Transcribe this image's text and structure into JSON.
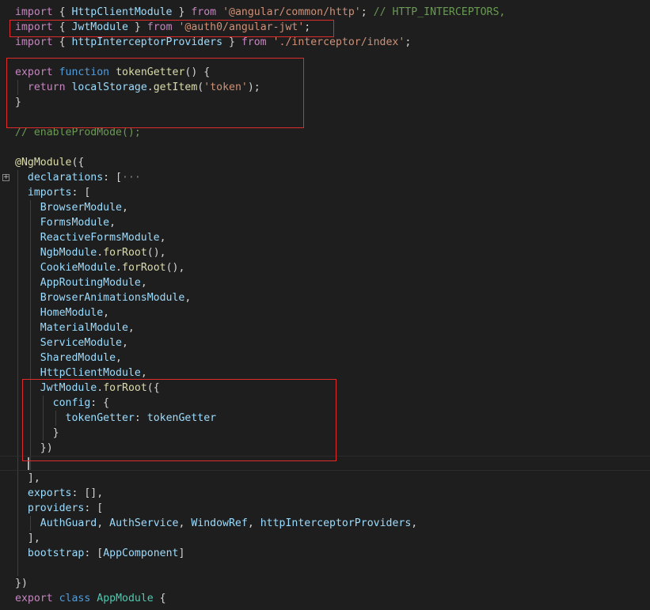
{
  "lines": [
    [
      [
        "kw",
        "import"
      ],
      [
        "pun",
        " { "
      ],
      [
        "var",
        "HttpClientModule"
      ],
      [
        "pun",
        " } "
      ],
      [
        "kw",
        "from"
      ],
      [
        "pun",
        " "
      ],
      [
        "str",
        "'@angular/common/http'"
      ],
      [
        "pun",
        "; "
      ],
      [
        "cmt",
        "// HTTP_INTERCEPTORS,"
      ]
    ],
    [
      [
        "kw",
        "import"
      ],
      [
        "pun",
        " { "
      ],
      [
        "var",
        "JwtModule"
      ],
      [
        "pun",
        " } "
      ],
      [
        "kw",
        "from"
      ],
      [
        "pun",
        " "
      ],
      [
        "str",
        "'@auth0/angular-jwt'"
      ],
      [
        "pun",
        ";"
      ]
    ],
    [
      [
        "kw",
        "import"
      ],
      [
        "pun",
        " { "
      ],
      [
        "var",
        "httpInterceptorProviders"
      ],
      [
        "pun",
        " } "
      ],
      [
        "kw",
        "from"
      ],
      [
        "pun",
        " "
      ],
      [
        "str",
        "'./interceptor/index'"
      ],
      [
        "pun",
        ";"
      ]
    ],
    [],
    [
      [
        "kw",
        "export"
      ],
      [
        "pun",
        " "
      ],
      [
        "kw2",
        "function"
      ],
      [
        "pun",
        " "
      ],
      [
        "fn",
        "tokenGetter"
      ],
      [
        "pun",
        "() {"
      ]
    ],
    [
      [
        "pun",
        "  "
      ],
      [
        "kw",
        "return"
      ],
      [
        "pun",
        " "
      ],
      [
        "var",
        "localStorage"
      ],
      [
        "pun",
        "."
      ],
      [
        "fn",
        "getItem"
      ],
      [
        "pun",
        "("
      ],
      [
        "str",
        "'token'"
      ],
      [
        "pun",
        ");"
      ]
    ],
    [
      [
        "pun",
        "}"
      ]
    ],
    [],
    [
      [
        "cmt",
        "// enableProdMode();"
      ]
    ],
    [],
    [
      [
        "fn",
        "@NgModule"
      ],
      [
        "pun",
        "({"
      ]
    ],
    [
      [
        "pun",
        "  "
      ],
      [
        "var",
        "declarations"
      ],
      [
        "pun",
        ": ["
      ],
      [
        "ellipsis",
        "···"
      ]
    ],
    [
      [
        "pun",
        "  "
      ],
      [
        "var",
        "imports"
      ],
      [
        "pun",
        ": ["
      ]
    ],
    [
      [
        "pun",
        "    "
      ],
      [
        "var",
        "BrowserModule"
      ],
      [
        "pun",
        ","
      ]
    ],
    [
      [
        "pun",
        "    "
      ],
      [
        "var",
        "FormsModule"
      ],
      [
        "pun",
        ","
      ]
    ],
    [
      [
        "pun",
        "    "
      ],
      [
        "var",
        "ReactiveFormsModule"
      ],
      [
        "pun",
        ","
      ]
    ],
    [
      [
        "pun",
        "    "
      ],
      [
        "var",
        "NgbModule"
      ],
      [
        "pun",
        "."
      ],
      [
        "fn",
        "forRoot"
      ],
      [
        "pun",
        "(),"
      ]
    ],
    [
      [
        "pun",
        "    "
      ],
      [
        "var",
        "CookieModule"
      ],
      [
        "pun",
        "."
      ],
      [
        "fn",
        "forRoot"
      ],
      [
        "pun",
        "(),"
      ]
    ],
    [
      [
        "pun",
        "    "
      ],
      [
        "var",
        "AppRoutingModule"
      ],
      [
        "pun",
        ","
      ]
    ],
    [
      [
        "pun",
        "    "
      ],
      [
        "var",
        "BrowserAnimationsModule"
      ],
      [
        "pun",
        ","
      ]
    ],
    [
      [
        "pun",
        "    "
      ],
      [
        "var",
        "HomeModule"
      ],
      [
        "pun",
        ","
      ]
    ],
    [
      [
        "pun",
        "    "
      ],
      [
        "var",
        "MaterialModule"
      ],
      [
        "pun",
        ","
      ]
    ],
    [
      [
        "pun",
        "    "
      ],
      [
        "var",
        "ServiceModule"
      ],
      [
        "pun",
        ","
      ]
    ],
    [
      [
        "pun",
        "    "
      ],
      [
        "var",
        "SharedModule"
      ],
      [
        "pun",
        ","
      ]
    ],
    [
      [
        "pun",
        "    "
      ],
      [
        "var",
        "HttpClientModule"
      ],
      [
        "pun",
        ","
      ]
    ],
    [
      [
        "pun",
        "    "
      ],
      [
        "var",
        "JwtModule"
      ],
      [
        "pun",
        "."
      ],
      [
        "fn",
        "forRoot"
      ],
      [
        "pun",
        "({"
      ]
    ],
    [
      [
        "pun",
        "      "
      ],
      [
        "var",
        "config"
      ],
      [
        "pun",
        ": {"
      ]
    ],
    [
      [
        "pun",
        "        "
      ],
      [
        "var",
        "tokenGetter"
      ],
      [
        "pun",
        ": "
      ],
      [
        "var",
        "tokenGetter"
      ]
    ],
    [
      [
        "pun",
        "      }"
      ]
    ],
    [
      [
        "pun",
        "    })"
      ]
    ],
    [],
    [
      [
        "pun",
        "  ],"
      ]
    ],
    [
      [
        "pun",
        "  "
      ],
      [
        "var",
        "exports"
      ],
      [
        "pun",
        ": [],"
      ]
    ],
    [
      [
        "pun",
        "  "
      ],
      [
        "var",
        "providers"
      ],
      [
        "pun",
        ": ["
      ]
    ],
    [
      [
        "pun",
        "    "
      ],
      [
        "var",
        "AuthGuard"
      ],
      [
        "pun",
        ", "
      ],
      [
        "var",
        "AuthService"
      ],
      [
        "pun",
        ", "
      ],
      [
        "var",
        "WindowRef"
      ],
      [
        "pun",
        ", "
      ],
      [
        "var",
        "httpInterceptorProviders"
      ],
      [
        "pun",
        ","
      ]
    ],
    [
      [
        "pun",
        "  ],"
      ]
    ],
    [
      [
        "pun",
        "  "
      ],
      [
        "var",
        "bootstrap"
      ],
      [
        "pun",
        ": ["
      ],
      [
        "var",
        "AppComponent"
      ],
      [
        "pun",
        "]"
      ]
    ],
    [],
    [
      [
        "pun",
        "})"
      ]
    ],
    [
      [
        "kw",
        "export"
      ],
      [
        "pun",
        " "
      ],
      [
        "kw2",
        "class"
      ],
      [
        "pun",
        " "
      ],
      [
        "ty",
        "AppModule"
      ],
      [
        "pun",
        " {"
      ]
    ]
  ],
  "colors": {
    "background": "#1e1e1e",
    "highlight_box": "#e02b2b",
    "keyword": "#c586c0",
    "string": "#ce9178",
    "comment": "#6a9955"
  }
}
